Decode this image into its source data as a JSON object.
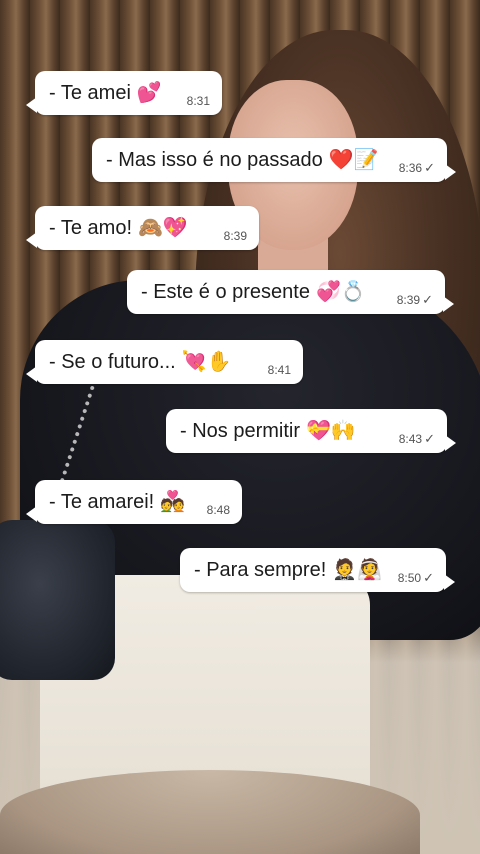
{
  "chat": {
    "messages": [
      {
        "text": "- Te amei",
        "emoji": "💕",
        "time": "8:31",
        "direction": "in",
        "read": false
      },
      {
        "text": "- Mas isso é no passado",
        "emoji": "❤️📝",
        "time": "8:36",
        "direction": "out",
        "read": true
      },
      {
        "text": "-  Te amo!",
        "emoji": "🙈💖",
        "time": "8:39",
        "direction": "in",
        "read": false
      },
      {
        "text": "- Este é o presente",
        "emoji": "💞💍",
        "time": "8:39",
        "direction": "out",
        "read": true
      },
      {
        "text": "- Se o futuro...",
        "emoji": "💘✋",
        "time": "8:41",
        "direction": "in",
        "read": false
      },
      {
        "text": "-  Nos permitir",
        "emoji": "💝🙌",
        "time": "8:43",
        "direction": "out",
        "read": true
      },
      {
        "text": "- Te amarei!",
        "emoji": "💑",
        "time": "8:48",
        "direction": "in",
        "read": false
      },
      {
        "text": "- Para sempre!",
        "emoji": "🤵👰",
        "time": "8:50",
        "direction": "out",
        "read": true
      }
    ],
    "read_tick": "✓"
  }
}
